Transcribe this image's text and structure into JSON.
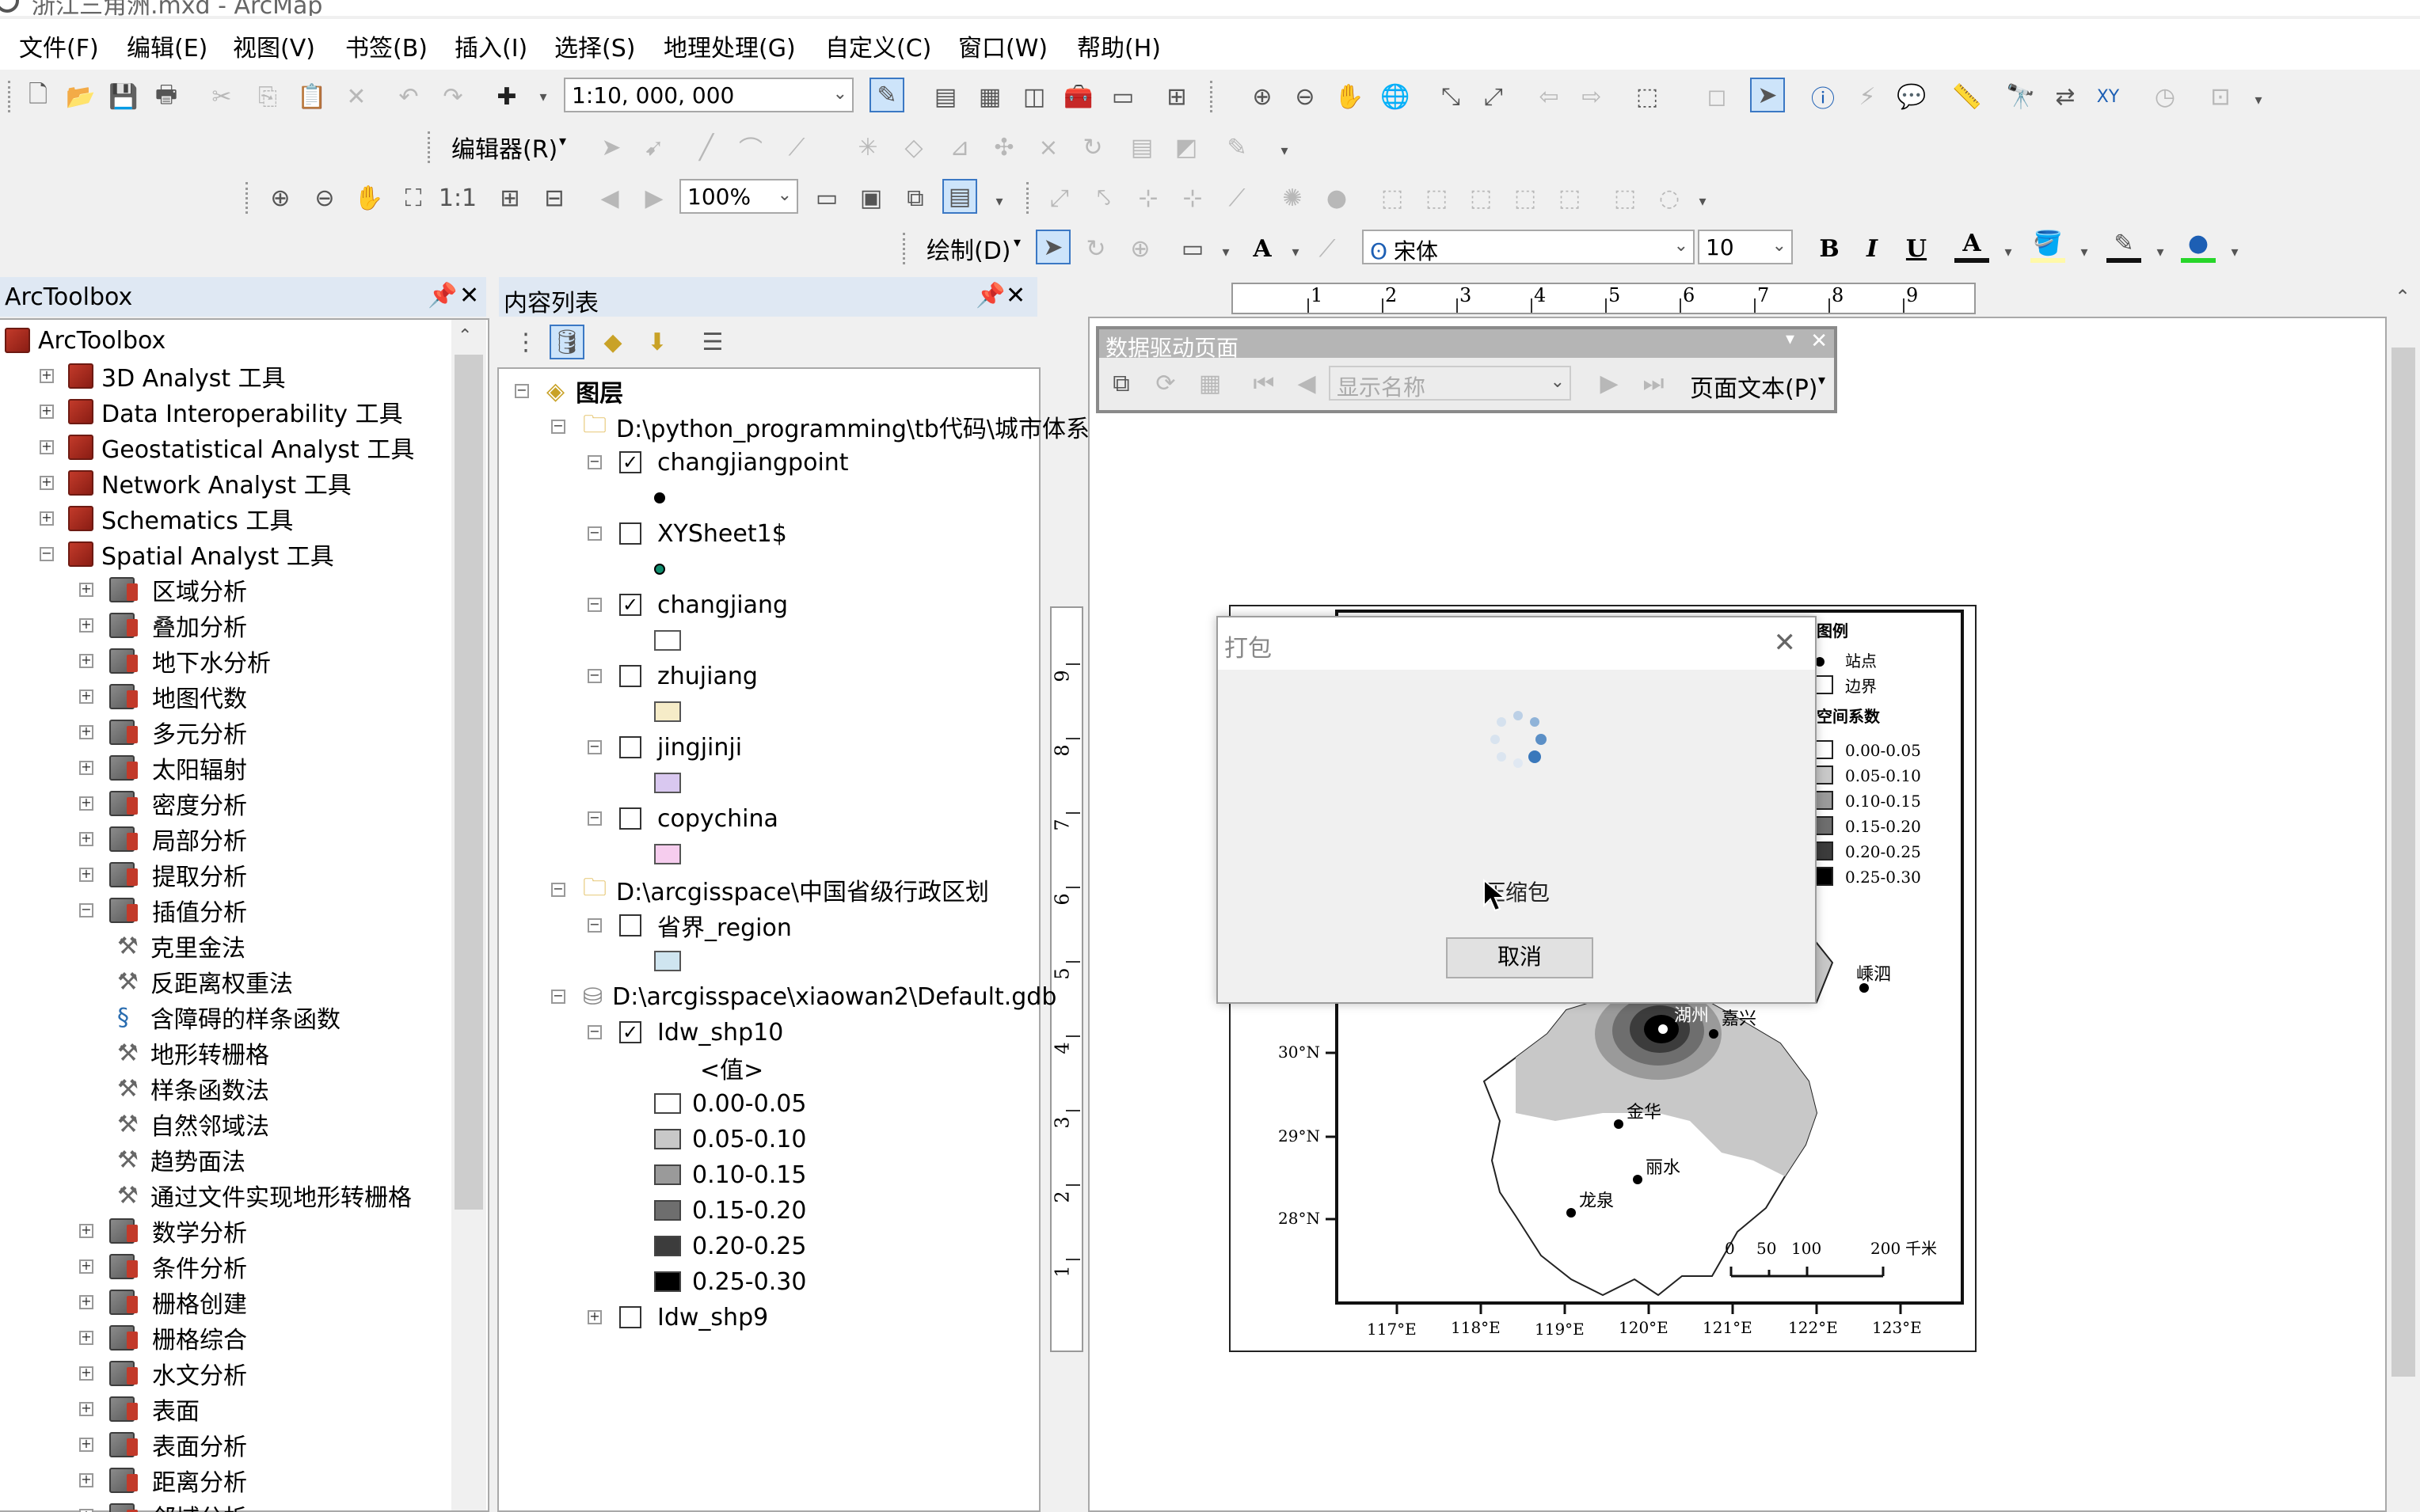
{
  "window": {
    "title": "浙江三角洲.mxd - ArcMap"
  },
  "menu": [
    "文件(F)",
    "编辑(E)",
    "视图(V)",
    "书签(B)",
    "插入(I)",
    "选择(S)",
    "地理处理(G)",
    "自定义(C)",
    "窗口(W)",
    "帮助(H)"
  ],
  "toolbar": {
    "scale": "1:10, 000, 000",
    "editor_label": "编辑器(R)",
    "zoom_percent": "100%",
    "draw_label": "绘制(D)",
    "font_name": "宋体",
    "font_size": "10",
    "bold": "B",
    "italic": "I",
    "underline": "U",
    "text_tool": "A"
  },
  "arctoolbox": {
    "title": "ArcToolbox",
    "root": "ArcToolbox",
    "toolboxes": [
      "3D Analyst 工具",
      "Data Interoperability 工具",
      "Geostatistical Analyst 工具",
      "Network Analyst 工具",
      "Schematics 工具",
      "Spatial Analyst 工具"
    ],
    "toolsets_a": [
      "区域分析",
      "叠加分析",
      "地下水分析",
      "地图代数",
      "多元分析",
      "太阳辐射",
      "密度分析",
      "局部分析",
      "提取分析",
      "插值分析"
    ],
    "tools": [
      "克里金法",
      "反距离权重法",
      "含障碍的样条函数",
      "地形转栅格",
      "样条函数法",
      "自然邻域法",
      "趋势面法",
      "通过文件实现地形转栅格"
    ],
    "toolsets_b": [
      "数学分析",
      "条件分析",
      "栅格创建",
      "栅格综合",
      "水文分析",
      "表面",
      "表面分析",
      "距离分析",
      "邻域分析"
    ]
  },
  "toc": {
    "title": "内容列表",
    "layers_root": "图层",
    "group1": "D:\\python_programming\\tb代码\\城市体系",
    "layers1": [
      {
        "name": "changjiangpoint",
        "checked": true,
        "symbol": "point-black"
      },
      {
        "name": "XYSheet1$",
        "checked": false,
        "symbol": "point-green"
      },
      {
        "name": "changjiang",
        "checked": true,
        "symbol": "box-white"
      },
      {
        "name": "zhujiang",
        "checked": false,
        "symbol": "box-cream"
      },
      {
        "name": "jingjinji",
        "checked": false,
        "symbol": "box-lilac"
      },
      {
        "name": "copychina",
        "checked": false,
        "symbol": "box-pink"
      }
    ],
    "group2": "D:\\arcgisspace\\中国省级行政区划",
    "layer2": {
      "name": "省界_region",
      "checked": false
    },
    "group3": "D:\\arcgisspace\\xiaowan2\\Default.gdb",
    "layer3": {
      "name": "Idw_shp10",
      "checked": true,
      "value_label": "<值>"
    },
    "classes": [
      {
        "label": "0.00-0.05",
        "color": "#ffffff"
      },
      {
        "label": "0.05-0.10",
        "color": "#c8c8c8"
      },
      {
        "label": "0.10-0.15",
        "color": "#9a9a9a"
      },
      {
        "label": "0.15-0.20",
        "color": "#6e6e6e"
      },
      {
        "label": "0.20-0.25",
        "color": "#3c3c3c"
      },
      {
        "label": "0.25-0.30",
        "color": "#000000"
      }
    ],
    "layer4": {
      "name": "Idw_shp9",
      "checked": false
    }
  },
  "ddp": {
    "title": "数据驱动页面",
    "name_placeholder": "显示名称",
    "page_text": "页面文本(P)"
  },
  "ruler": {
    "h": [
      "1",
      "2",
      "3",
      "4",
      "5",
      "6",
      "7",
      "8",
      "9"
    ],
    "v": [
      "9",
      "8",
      "7",
      "6",
      "5",
      "4",
      "3",
      "2",
      "1"
    ]
  },
  "map": {
    "legend_title": "图例",
    "legend_items": [
      "站点",
      "边界"
    ],
    "legend_coef": "空间系数",
    "classes": [
      "0.00-0.05",
      "0.05-0.10",
      "0.10-0.15",
      "0.15-0.20",
      "0.20-0.25",
      "0.25-0.30"
    ],
    "lat": [
      "30°N",
      "29°N",
      "28°N"
    ],
    "lon": [
      "117°E",
      "118°E",
      "119°E",
      "120°E",
      "121°E",
      "122°E",
      "123°E"
    ],
    "places": [
      "湖州",
      "嵊泗",
      "金华",
      "丽水",
      "龙泉",
      "嘉兴"
    ],
    "scalebar": [
      "0",
      "50",
      "100",
      "200",
      "千米"
    ]
  },
  "dialog": {
    "title": "打包",
    "message": "压缩包",
    "cancel": "取消"
  }
}
